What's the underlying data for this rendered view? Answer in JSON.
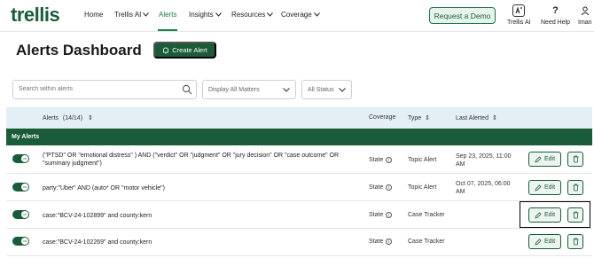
{
  "brand": {
    "logo": "trellis"
  },
  "nav": {
    "links": [
      {
        "label": "Home"
      },
      {
        "label": "Trellis AI"
      },
      {
        "label": "Alerts"
      },
      {
        "label": "Insights"
      },
      {
        "label": "Resources"
      },
      {
        "label": "Coverage"
      }
    ],
    "demo_label": "Request a Demo",
    "icon_items": [
      {
        "label": "Trellis AI"
      },
      {
        "label": "Need Help"
      },
      {
        "label": "Iman"
      }
    ]
  },
  "page": {
    "title": "Alerts Dashboard",
    "create_label": "Create Alert"
  },
  "filters": {
    "search_placeholder": "Search within alerts",
    "matters_value": "Display All Matters",
    "status_value": "All Status"
  },
  "table": {
    "headers": {
      "alerts": "Alerts",
      "alerts_count": "(14/14)",
      "coverage": "Coverage",
      "type": "Type",
      "last_alerted": "Last Alerted"
    },
    "group": "My Alerts",
    "edit_label": "Edit",
    "toggle_label": "ON",
    "rows": [
      {
        "text": "(\"PTSD\" OR \"emotional distress\" ) AND (\"verdict\" OR \"judgment\" OR \"jury decision\" OR \"case outcome\" OR \"summary judgment\")",
        "coverage": "State",
        "type": "Topic Alert",
        "last": "Sep 23, 2025, 11:00 AM"
      },
      {
        "text": "party:\"Uber\" AND (auto* OR \"motor vehicle\")",
        "coverage": "State",
        "type": "Topic Alert",
        "last": "Oct 07, 2025, 06:00 AM"
      },
      {
        "text": "case:\"BCV-24-102899\" and county:kern",
        "coverage": "State",
        "type": "Case Tracker",
        "last": ""
      },
      {
        "text": "case:\"BCV-24-102269\" and county:kern",
        "coverage": "State",
        "type": "Case Tracker",
        "last": ""
      }
    ]
  },
  "colors": {
    "brand_green": "#1a5c3a",
    "header_blue": "#e3eef5"
  }
}
